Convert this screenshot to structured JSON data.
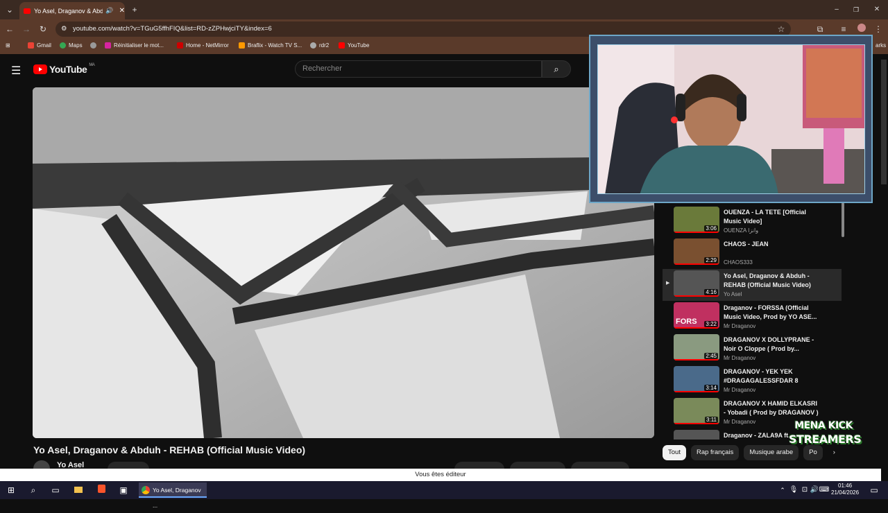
{
  "browser": {
    "tab_title": "Yo Asel, Draganov & Abdu",
    "url": "youtube.com/watch?v=TGuG5ffhFIQ&list=RD-zZPHwjciTY&index=6",
    "bookmarks": [
      "Gmail",
      "Maps",
      "Réinitialiser le mot...",
      "Home - NetMirror",
      "Braflix - Watch TV S...",
      "rdr2",
      "YouTube"
    ],
    "bookmarks_overflow": "arks"
  },
  "youtube": {
    "logo_text": "YouTube",
    "region": "MA",
    "search_placeholder": "Rechercher",
    "video_title": "Yo Asel, Draganov & Abduh - REHAB (Official Music Video)",
    "channel": "Yo Asel"
  },
  "playlist": [
    {
      "title": "OUENZA - LA TETE [Official Music Video]",
      "channel": "OUENZA وانزا",
      "duration": "3:06",
      "thumb": "#6a7a3a"
    },
    {
      "title": "CHAOS - JEAN",
      "channel": "CHAOS333",
      "duration": "2:29",
      "thumb": "#7a5030"
    },
    {
      "title": "Yo Asel, Draganov & Abduh - REHAB (Official Music Video)",
      "channel": "Yo Asel",
      "duration": "4:16",
      "thumb": "#555555",
      "active": true,
      "marker": "▶"
    },
    {
      "title": "Draganov - FORSSA (Official Music Video, Prod by YO ASE...",
      "channel": "Mr Draganov",
      "duration": "3:22",
      "thumb": "#c03060",
      "thumb_text": "FORS"
    },
    {
      "title": "DRAGANOV X DOLLYPRANE - Noir O Cloppe ( Prod by...",
      "channel": "Mr Draganov",
      "duration": "2:45",
      "thumb": "#8a9a80"
    },
    {
      "title": "DRAGANOV - YEK YEK #DRAGAGALESSFDAR 8",
      "channel": "Mr Draganov",
      "duration": "3:14",
      "thumb": "#4a6a8a"
    },
    {
      "title": "DRAGANOV X HAMID ELKASRI - Yobadi ( Prod by DRAGANOV )",
      "channel": "Mr Draganov",
      "duration": "3:11",
      "thumb": "#7a8a5a"
    },
    {
      "title": "Draganov - ZALA9A ft...",
      "channel": "",
      "duration": "",
      "thumb": "#555555"
    }
  ],
  "chips": [
    "Tout",
    "Rap français",
    "Musique arabe",
    "Po"
  ],
  "overlay": {
    "kick_line1": "MENA KICK",
    "kick_line2": "STREAMERS"
  },
  "notice": "Vous êtes éditeur",
  "taskbar": {
    "app_label": "Yo Asel, Draganov ...",
    "time": "01:46",
    "date": "21/04/2026"
  },
  "colors": {
    "accent": "#ff0000",
    "tabstrip": "#3a2a22",
    "toolbar": "#5a3a2a",
    "overlay_frame": "#6ea7c8"
  }
}
